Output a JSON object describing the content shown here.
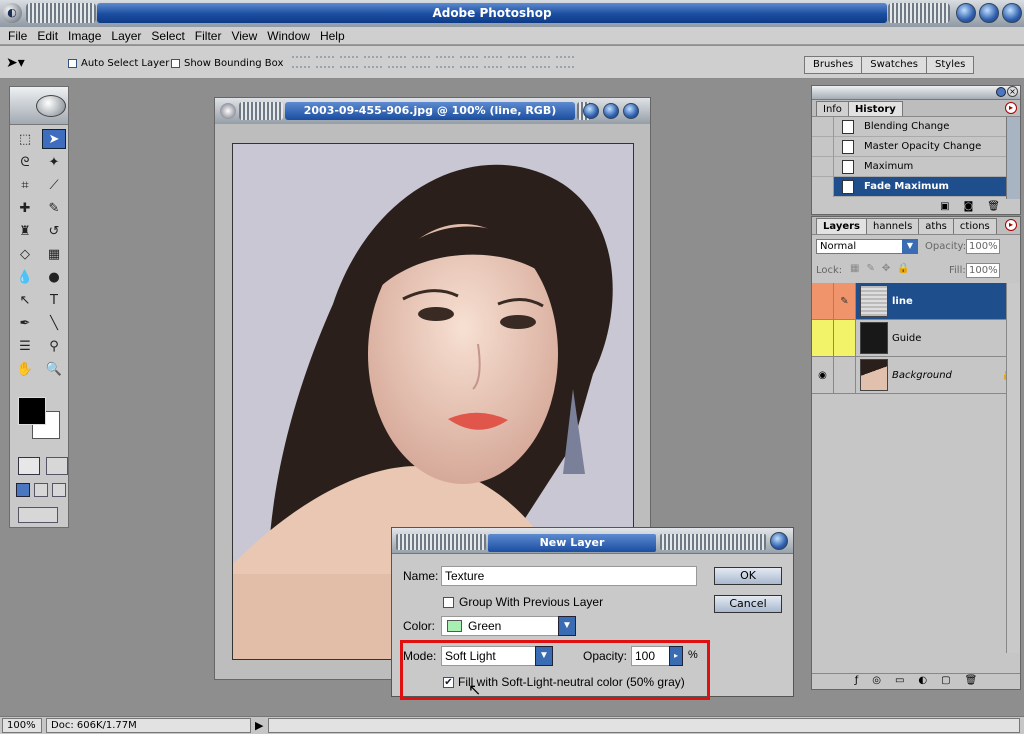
{
  "app": {
    "title": "Adobe Photoshop",
    "logo_glyph": "◐"
  },
  "menu": [
    "File",
    "Edit",
    "Image",
    "Layer",
    "Select",
    "Filter",
    "View",
    "Window",
    "Help"
  ],
  "options": {
    "auto_select_layer": "Auto Select Layer",
    "show_bounding_box": "Show Bounding Box"
  },
  "palette_well": {
    "tabs": [
      "Brushes",
      "Swatches",
      "Styles"
    ]
  },
  "document": {
    "title": "2003-09-455-906.jpg @ 100% (line, RGB)"
  },
  "history_panel": {
    "tabs": [
      "Info",
      "History"
    ],
    "items": [
      {
        "label": "Blending Change",
        "selected": false
      },
      {
        "label": "Master Opacity Change",
        "selected": false
      },
      {
        "label": "Maximum",
        "selected": false
      },
      {
        "label": "Fade Maximum",
        "selected": true
      }
    ]
  },
  "layers_panel": {
    "tabs": [
      "Layers",
      "Channels",
      "Paths",
      "Actions"
    ],
    "tabs_visible": [
      "Layers",
      "hannels",
      "aths",
      "ctions"
    ],
    "blend_mode": "Normal",
    "opacity_label": "Opacity:",
    "opacity_value": "100%",
    "lock_label": "Lock:",
    "fill_label": "Fill:",
    "fill_value": "100%",
    "layers": [
      {
        "name": "line",
        "selected": true,
        "color": "#f0956b"
      },
      {
        "name": "Guide",
        "selected": false,
        "color": "#f3f36a"
      },
      {
        "name": "Background",
        "selected": false,
        "color": "#c6c6c6"
      }
    ]
  },
  "dialog": {
    "title": "New Layer",
    "name_label": "Name:",
    "name_value": "Texture",
    "group_label": "Group With Previous Layer",
    "color_label": "Color:",
    "color_value": "Green",
    "color_swatch": "#a8f0b2",
    "mode_label": "Mode:",
    "mode_value": "Soft Light",
    "opacity_label": "Opacity:",
    "opacity_value": "100",
    "opacity_unit": "%",
    "fill_label": "Fill with Soft-Light-neutral color (50% gray)",
    "ok_label": "OK",
    "cancel_label": "Cancel"
  },
  "status": {
    "zoom": "100%",
    "doc": "Doc: 606K/1.77M"
  },
  "colors": {
    "accent": "#1e4e8c",
    "highlight": "#e01010"
  }
}
